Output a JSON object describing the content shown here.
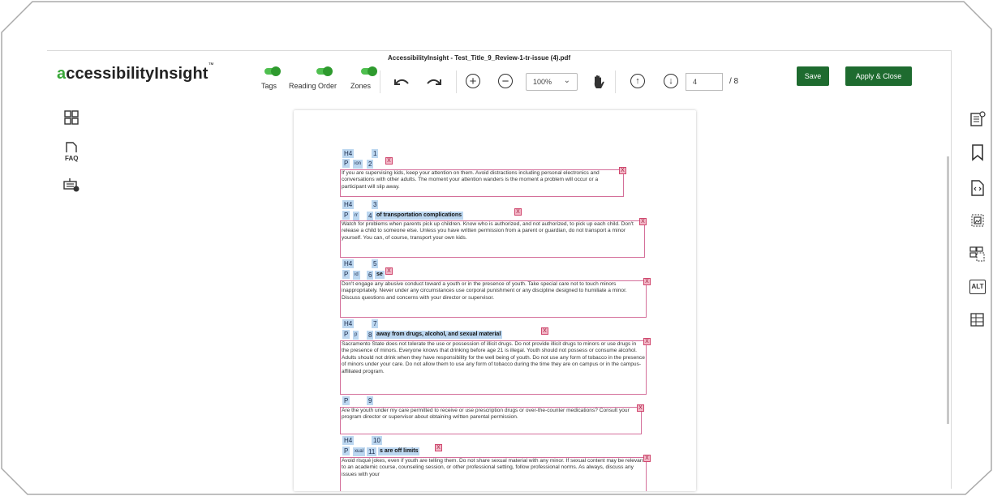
{
  "app": {
    "title": "AccessibilityInsight - Test_Title_9_Review-1-tr-issue (4).pdf",
    "logo_prefix": "a",
    "logo_rest": "ccessibilityInsight",
    "logo_tm": "™"
  },
  "toggles": [
    {
      "label": "Tags",
      "on": true
    },
    {
      "label": "Reading Order",
      "on": true
    },
    {
      "label": "Zones",
      "on": true
    }
  ],
  "toolbar": {
    "zoom": "100%",
    "page_current": "4",
    "page_total": "/ 8",
    "save_label": "Save",
    "apply_label": "Apply & Close"
  },
  "left_icons": [
    "grid-view-icon",
    "faq-icon",
    "keyboard-settings-icon"
  ],
  "left_labels": {
    "faq": "FAQ"
  },
  "right_icons": [
    "properties-icon",
    "bookmark-icon",
    "code-icon",
    "image-zone-icon",
    "zone-select-icon",
    "alt-text-icon",
    "table-icon"
  ],
  "right_labels": {
    "alt": "ALT"
  },
  "colors": {
    "accent": "#1e6b2f",
    "toggle": "#4fbf4f",
    "tag_bg": "#bcd7f0",
    "zone_border": "#d46f9a"
  },
  "document": {
    "blocks": [
      {
        "tag_h": "H4",
        "num_h": "1",
        "tag_p": "P",
        "num_p": "2",
        "frag": "ion",
        "heading": "",
        "x": "X",
        "text": "If you are supervising kids, keep your attention on them. Avoid distractions including personal electronics and conversations with other adults. The moment your attention wanders is the moment a problem will occur or a participant will slip away."
      },
      {
        "tag_h": "H4",
        "num_h": "3",
        "tag_p": "P",
        "num_p": "4",
        "frag": "rr",
        "heading": "of transportation complications",
        "x": "X",
        "text": "Watch for problems when parents pick up children. Know who is authorized, and not authorized, to pick up each child. Don't release a child to someone else. Unless you have written permission from a parent or guardian, do not transport a minor yourself. You can, of course, transport your own kids."
      },
      {
        "tag_h": "H4",
        "num_h": "5",
        "tag_p": "P",
        "num_p": "6",
        "frag": "id",
        "heading": "se",
        "x": "X",
        "text": "Don't engage any abusive conduct toward a youth or in the presence of youth. Take special care not to touch minors inappropriately. Never under any circumstances use corporal punishment or any discipline designed to humiliate a minor. Discuss questions and concerns with your director or supervisor."
      },
      {
        "tag_h": "H4",
        "num_h": "7",
        "tag_p": "P",
        "num_p": "8",
        "frag": "p",
        "heading": "away from drugs, alcohol, and sexual material",
        "x": "X",
        "text": "Sacramento State does not tolerate the use or possession of illicit drugs. Do not provide illicit drugs to minors or use drugs in the presence of minors. Everyone knows that drinking before age 21 is illegal. Youth should not possess or consume alcohol. Adults should not drink when they have responsibility for the well being of youth. Do not use any form of tobacco in the presence of minors under your care. Do not allow them to use any form of tobacco during the time they are on campus or in the campus-affiliated program."
      },
      {
        "tag_h": "",
        "num_h": "",
        "tag_p": "P",
        "num_p": "9",
        "frag": "",
        "heading": "",
        "x": "X",
        "text": "Are the youth under my care permitted to receive or use prescription drugs or over-the-counter medications? Consult your program director or supervisor about obtaining written parental permission."
      },
      {
        "tag_h": "H4",
        "num_h": "10",
        "tag_p": "P",
        "num_p": "11",
        "frag": "xual",
        "heading": "s are off limits",
        "x": "X",
        "text": "Avoid risqué jokes, even if youth are telling them. Do not share sexual material with any minor. If sexual content may be relevant to an academic course, counseling session, or other professional setting, follow professional norms. As always, discuss any issues with your"
      }
    ]
  }
}
